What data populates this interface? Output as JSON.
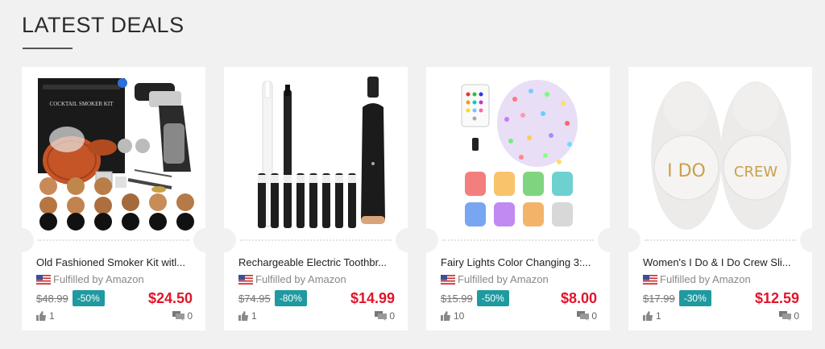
{
  "section": {
    "title": "LATEST DEALS"
  },
  "colors": {
    "price": "#e0152a",
    "badge": "#1f9aa0",
    "background": "#f1f1f1"
  },
  "deals": [
    {
      "image_icon": "smoker-kit-image",
      "title": "Old Fashioned Smoker Kit witl...",
      "fulfilled": "Fulfilled by Amazon",
      "old_price": "$48.99",
      "discount": "-50%",
      "price": "$24.50",
      "likes": "1",
      "comments": "0"
    },
    {
      "image_icon": "toothbrush-image",
      "title": "Rechargeable Electric Toothbr...",
      "fulfilled": "Fulfilled by Amazon",
      "old_price": "$74.95",
      "discount": "-80%",
      "price": "$14.99",
      "likes": "1",
      "comments": "0"
    },
    {
      "image_icon": "fairy-lights-image",
      "title": "Fairy Lights Color Changing 3:...",
      "fulfilled": "Fulfilled by Amazon",
      "old_price": "$15.99",
      "discount": "-50%",
      "price": "$8.00",
      "likes": "10",
      "comments": "0"
    },
    {
      "image_icon": "slippers-image",
      "title": "Women's I Do & I Do Crew Sli...",
      "fulfilled": "Fulfilled by Amazon",
      "old_price": "$17.99",
      "discount": "-30%",
      "price": "$12.59",
      "likes": "1",
      "comments": "0",
      "slipper_text_left": "I DO",
      "slipper_text_right": "CREW"
    }
  ]
}
